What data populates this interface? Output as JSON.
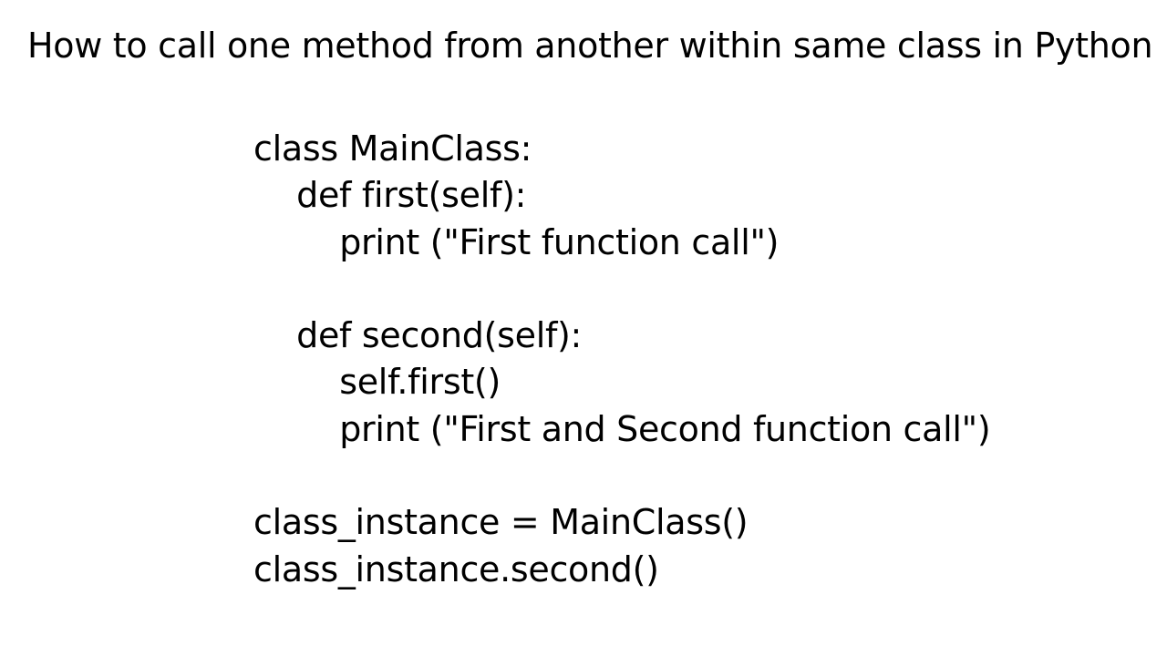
{
  "title": "How to call one method from another within same class in Python",
  "code": {
    "line1": "class MainClass:",
    "line2": "    def first(self):",
    "line3": "        print (\"First function call\")",
    "line4": "",
    "line5": "    def second(self):",
    "line6": "        self.first()",
    "line7": "        print (\"First and Second function call\")",
    "line8": "",
    "line9": "class_instance = MainClass()",
    "line10": "class_instance.second()"
  }
}
